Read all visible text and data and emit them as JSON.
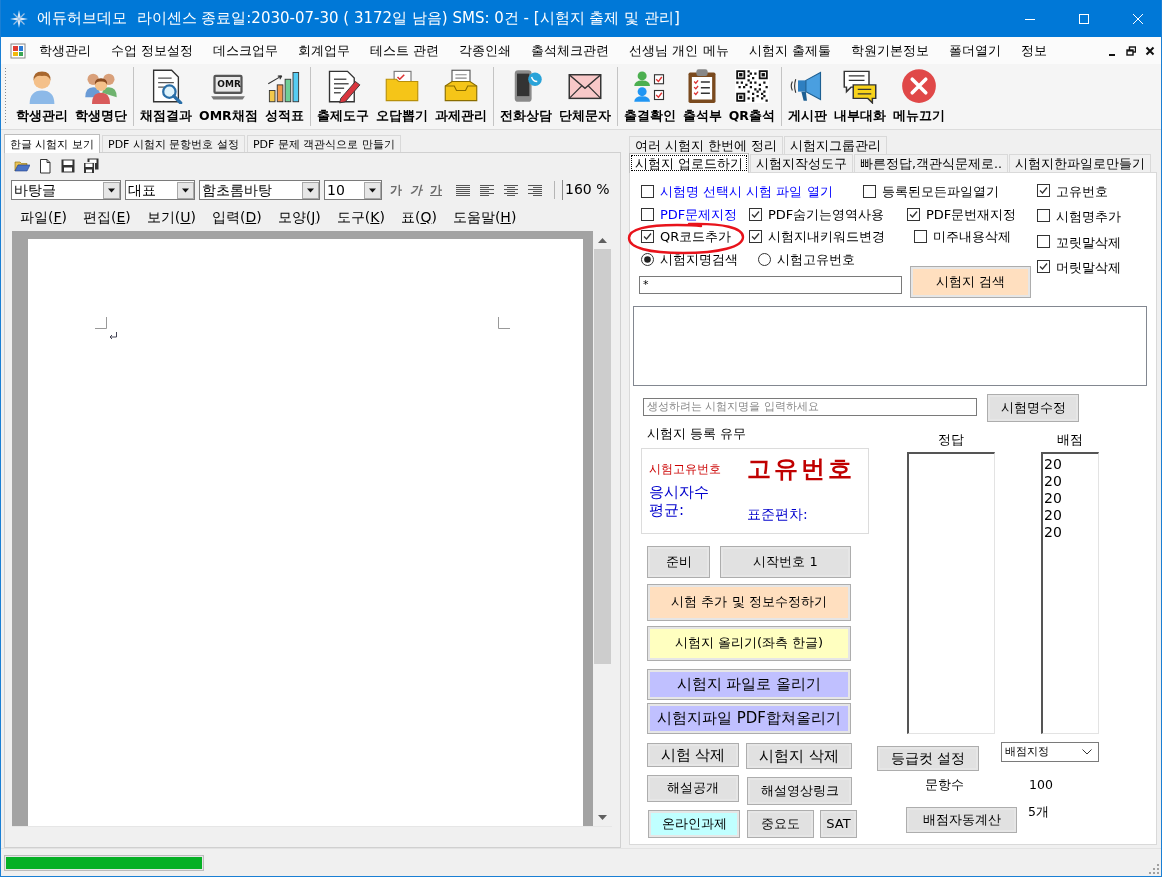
{
  "window": {
    "title": "에듀허브데모  라이센스 종료일:2030-07-30 ( 3172일 남음) SMS: 0건 - [시험지 출제 및 관리]"
  },
  "menu_bar": [
    "학생관리",
    "수업 정보설정",
    "데스크업무",
    "회계업무",
    "테스트 관련",
    "각종인쇄",
    "출석체크관련",
    "선생님 개인 메뉴",
    "시험지 출제툴",
    "학원기본정보",
    "폴더열기",
    "정보"
  ],
  "toolbar": [
    [
      {
        "label": "학생관리"
      },
      {
        "label": "학생명단"
      }
    ],
    [
      {
        "label": "채점결과"
      },
      {
        "label": "OMR채점",
        "icon_text": "OMR"
      },
      {
        "label": "성적표"
      }
    ],
    [
      {
        "label": "출제도구"
      },
      {
        "label": "오답뽑기"
      },
      {
        "label": "과제관리"
      }
    ],
    [
      {
        "label": "전화상담"
      },
      {
        "label": "단체문자"
      }
    ],
    [
      {
        "label": "출결확인"
      },
      {
        "label": "출석부"
      },
      {
        "label": "QR출석"
      }
    ],
    [
      {
        "label": "게시판"
      },
      {
        "label": "내부대화"
      },
      {
        "label": "메뉴끄기"
      }
    ]
  ],
  "left_pane": {
    "tabs": [
      {
        "label": "한글 시험지 보기",
        "selected": true
      },
      {
        "label": "PDF 시험지 문항번호 설정",
        "selected": false
      },
      {
        "label": "PDF 문제 객관식으로 만들기",
        "selected": false
      }
    ],
    "format_bar": {
      "style": "바탕글",
      "language": "대표",
      "font": "함초롬바탕",
      "size": "10",
      "char_buttons": [
        "가",
        "가",
        "가"
      ],
      "zoom": "160 %"
    },
    "editor_menu": [
      "파일(F)",
      "편집(E)",
      "보기(U)",
      "입력(D)",
      "모양(J)",
      "도구(K)",
      "표(Q)",
      "도움말(H)"
    ]
  },
  "right_pane": {
    "tab_rows": [
      [
        {
          "label": "여러 시험지 한번에 정리",
          "selected": false
        },
        {
          "label": "시험지그룹관리",
          "selected": false
        }
      ],
      [
        {
          "label": "시험지 업로드하기",
          "selected": true
        },
        {
          "label": "시험지작성도구",
          "selected": false
        },
        {
          "label": "빠른정답,객관식문제로..",
          "selected": false
        },
        {
          "label": "시험지한파일로만들기",
          "selected": false
        }
      ]
    ],
    "option_rows": [
      [
        {
          "kind": "checkbox",
          "label": "시험명 선택시 시험 파일 열기",
          "checked": false,
          "color": "#0000ff",
          "circled": false
        },
        {
          "kind": "checkbox",
          "label": "등록된모든파일열기",
          "checked": false,
          "circled": false
        }
      ],
      [
        {
          "kind": "checkbox",
          "label": "PDF문제지정",
          "checked": false,
          "color": "#0000ff",
          "circled": false
        },
        {
          "kind": "checkbox",
          "label": "PDF숨기는영역사용",
          "checked": true,
          "circled": false
        },
        {
          "kind": "checkbox",
          "label": "PDF문번재지정",
          "checked": true,
          "circled": false
        }
      ],
      [
        {
          "kind": "checkbox",
          "label": "QR코드추가",
          "checked": true,
          "circled": true
        },
        {
          "kind": "checkbox",
          "label": "시험지내키워드변경",
          "checked": true,
          "circled": false
        },
        {
          "kind": "checkbox",
          "label": "미주내용삭제",
          "checked": false,
          "circled": false
        }
      ],
      [
        {
          "kind": "radio",
          "label": "시험지명검색",
          "selected": true,
          "circled": false
        },
        {
          "kind": "radio",
          "label": "시험고유번호",
          "selected": false,
          "circled": false
        }
      ]
    ],
    "side_options": [
      {
        "kind": "checkbox",
        "label": "고유번호",
        "checked": true,
        "circled": false
      },
      {
        "kind": "checkbox",
        "label": "시험명추가",
        "checked": false,
        "circled": false
      },
      {
        "kind": "checkbox",
        "label": "꼬릿말삭제",
        "checked": false,
        "circled": false
      },
      {
        "kind": "checkbox",
        "label": "머릿말삭제",
        "checked": true,
        "circled": false
      }
    ],
    "search_field": {
      "value": "*"
    },
    "search_button": {
      "label": "시험지 검색",
      "color": "#ffdfbf"
    },
    "name_field": {
      "placeholder": "생성하려는 시험지명을 입력하세요"
    },
    "rename_button": {
      "label": "시험명수정",
      "color": "#e1e1e1"
    },
    "registration": {
      "title": "시험지 등록 유무",
      "id_caption": "시험고유번호",
      "id_value": "고유번호",
      "examinees": "응시자수",
      "average": "평균:",
      "std_dev": "표준편차:"
    },
    "action_buttons": [
      [
        {
          "label": "준비",
          "color": "#e1e1e1"
        },
        {
          "label": "시작번호 1",
          "color": "#e1e1e1"
        }
      ],
      [
        {
          "label": "시험 추가 및 정보수정하기",
          "color": "#ffdfbf"
        }
      ],
      [
        {
          "label": "시험지 올리기(좌측 한글)",
          "color": "#ffffc0"
        }
      ],
      [
        {
          "label": "시험지 파일로 올리기",
          "color": "#c0c0ff"
        }
      ],
      [
        {
          "label": "시험지파일 PDF합쳐올리기",
          "color": "#c0c0ff"
        }
      ],
      [
        {
          "label": "시험 삭제",
          "color": "#e1e1e1"
        },
        {
          "label": "시험지 삭제",
          "color": "#e1e1e1"
        }
      ],
      [
        {
          "label": "해설공개",
          "color": "#e1e1e1"
        },
        {
          "label": "해설영상링크",
          "color": "#e1e1e1"
        }
      ],
      [
        {
          "label": "온라인과제",
          "color": "#c0ffff"
        },
        {
          "label": "중요도",
          "color": "#e1e1e1"
        },
        {
          "label": "SAT",
          "color": "#e1e1e1"
        }
      ]
    ],
    "answers": {
      "heading": "정답"
    },
    "scores": {
      "heading": "배점",
      "items": [
        "20",
        "20",
        "20",
        "20",
        "20"
      ]
    },
    "grade_cut_button": {
      "label": "등급컷 설정",
      "color": "#e1e1e1"
    },
    "score_dropdown": {
      "value": "배점지정"
    },
    "question_count": {
      "label": "문항수",
      "value": "100"
    },
    "auto_score_button": {
      "label": "배점자동계산",
      "color": "#e1e1e1"
    },
    "item_count": "5개"
  },
  "status_bar": {
    "progress": {
      "level": 1
    }
  }
}
